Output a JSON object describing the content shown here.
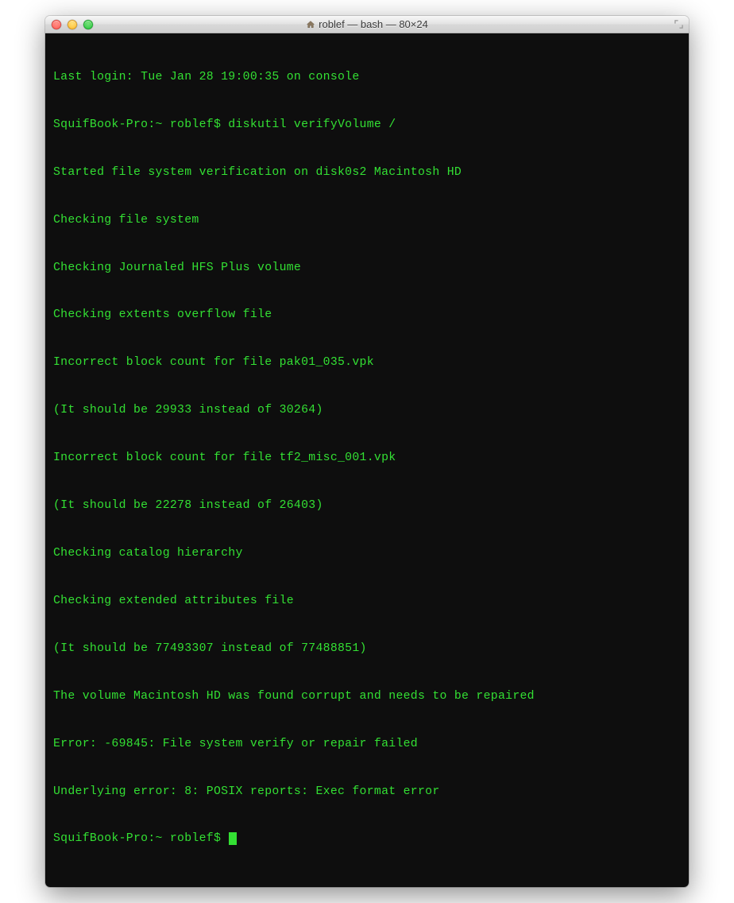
{
  "window": {
    "title": "roblef — bash — 80×24"
  },
  "terminal": {
    "lines": [
      "Last login: Tue Jan 28 19:00:35 on console",
      "SquifBook-Pro:~ roblef$ diskutil verifyVolume /",
      "Started file system verification on disk0s2 Macintosh HD",
      "Checking file system",
      "Checking Journaled HFS Plus volume",
      "Checking extents overflow file",
      "Incorrect block count for file pak01_035.vpk",
      "(It should be 29933 instead of 30264)",
      "Incorrect block count for file tf2_misc_001.vpk",
      "(It should be 22278 instead of 26403)",
      "Checking catalog hierarchy",
      "Checking extended attributes file",
      "(It should be 77493307 instead of 77488851)",
      "The volume Macintosh HD was found corrupt and needs to be repaired",
      "Error: -69845: File system verify or repair failed",
      "Underlying error: 8: POSIX reports: Exec format error"
    ],
    "prompt": "SquifBook-Pro:~ roblef$ "
  },
  "colors": {
    "terminal_bg": "#0e0e0e",
    "terminal_fg": "#33e033"
  }
}
